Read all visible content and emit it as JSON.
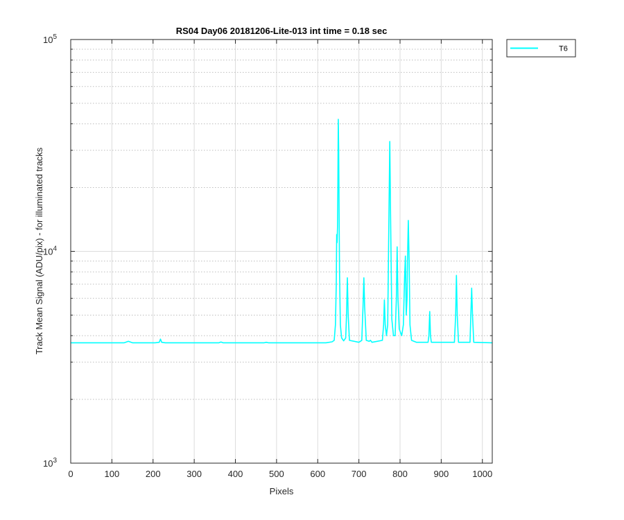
{
  "chart_data": {
    "type": "line",
    "title": "RS04 Day06 20181206-Lite-013 int time = 0.18 sec",
    "xlabel": "Pixels",
    "ylabel": "Track Mean Signal (ADU/pix) - for illuminated tracks",
    "xlim": [
      0,
      1024
    ],
    "ylim": [
      1000,
      100000
    ],
    "yscale": "log",
    "grid": true,
    "legend_position": "outside-top-right",
    "x_ticks": [
      "0",
      "100",
      "200",
      "300",
      "400",
      "500",
      "600",
      "700",
      "800",
      "900",
      "1000"
    ],
    "y_ticks": [
      {
        "base": "10",
        "exp": "3",
        "value": 1000
      },
      {
        "base": "10",
        "exp": "4",
        "value": 10000
      },
      {
        "base": "10",
        "exp": "5",
        "value": 100000
      }
    ],
    "series": [
      {
        "name": "T6",
        "color": "#00ffff",
        "baseline": 3700,
        "points": [
          [
            0,
            3700
          ],
          [
            130,
            3700
          ],
          [
            140,
            3760
          ],
          [
            150,
            3700
          ],
          [
            205,
            3700
          ],
          [
            215,
            3720
          ],
          [
            218,
            3850
          ],
          [
            221,
            3720
          ],
          [
            230,
            3700
          ],
          [
            360,
            3700
          ],
          [
            365,
            3730
          ],
          [
            370,
            3700
          ],
          [
            470,
            3700
          ],
          [
            475,
            3720
          ],
          [
            480,
            3700
          ],
          [
            620,
            3700
          ],
          [
            635,
            3740
          ],
          [
            640,
            3800
          ],
          [
            643,
            4500
          ],
          [
            645,
            7000
          ],
          [
            646,
            12000
          ],
          [
            647,
            11000
          ],
          [
            648,
            13000
          ],
          [
            649,
            20000
          ],
          [
            650,
            42000
          ],
          [
            651,
            30000
          ],
          [
            653,
            8000
          ],
          [
            655,
            4500
          ],
          [
            658,
            3900
          ],
          [
            663,
            3780
          ],
          [
            668,
            3900
          ],
          [
            670,
            5000
          ],
          [
            672,
            7500
          ],
          [
            674,
            5000
          ],
          [
            677,
            3800
          ],
          [
            700,
            3720
          ],
          [
            707,
            3800
          ],
          [
            710,
            5500
          ],
          [
            712,
            7500
          ],
          [
            714,
            5500
          ],
          [
            718,
            3800
          ],
          [
            725,
            3760
          ],
          [
            728,
            3800
          ],
          [
            732,
            3720
          ],
          [
            757,
            3800
          ],
          [
            760,
            4500
          ],
          [
            762,
            5900
          ],
          [
            764,
            4500
          ],
          [
            767,
            4000
          ],
          [
            770,
            4500
          ],
          [
            773,
            15000
          ],
          [
            775,
            33000
          ],
          [
            777,
            15000
          ],
          [
            780,
            4800
          ],
          [
            784,
            4000
          ],
          [
            788,
            4000
          ],
          [
            791,
            6000
          ],
          [
            793,
            10500
          ],
          [
            795,
            6000
          ],
          [
            798,
            4300
          ],
          [
            804,
            4000
          ],
          [
            808,
            4500
          ],
          [
            811,
            7500
          ],
          [
            813,
            9500
          ],
          [
            815,
            5000
          ],
          [
            817,
            6000
          ],
          [
            818,
            9000
          ],
          [
            820,
            14000
          ],
          [
            822,
            9000
          ],
          [
            824,
            4500
          ],
          [
            828,
            3800
          ],
          [
            840,
            3720
          ],
          [
            868,
            3720
          ],
          [
            870,
            4000
          ],
          [
            872,
            5200
          ],
          [
            874,
            4000
          ],
          [
            876,
            3720
          ],
          [
            932,
            3720
          ],
          [
            935,
            5000
          ],
          [
            937,
            7700
          ],
          [
            939,
            5000
          ],
          [
            942,
            3720
          ],
          [
            970,
            3720
          ],
          [
            972,
            5000
          ],
          [
            974,
            6700
          ],
          [
            976,
            5000
          ],
          [
            979,
            3720
          ],
          [
            1024,
            3700
          ]
        ]
      }
    ]
  }
}
